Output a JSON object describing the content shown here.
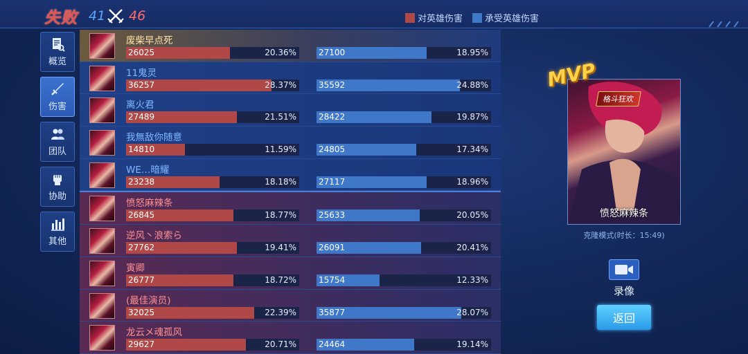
{
  "header": {
    "result": "失败",
    "blue_kills": "41",
    "red_kills": "46",
    "legend": [
      {
        "label": "对英雄伤害",
        "color": "#b04848"
      },
      {
        "label": "承受英雄伤害",
        "color": "#3f78c8"
      }
    ]
  },
  "sidebar": {
    "items": [
      {
        "label": "概览",
        "icon": "overview-icon",
        "active": false
      },
      {
        "label": "伤害",
        "icon": "sword-icon",
        "active": true
      },
      {
        "label": "团队",
        "icon": "team-icon",
        "active": false
      },
      {
        "label": "协助",
        "icon": "fist-icon",
        "active": false
      },
      {
        "label": "其他",
        "icon": "bar-chart-icon",
        "active": false
      }
    ]
  },
  "players": [
    {
      "name": "废柴早点死",
      "dealt": "26025",
      "dealt_pct": "20.36%",
      "dealt_ratio": 0.6,
      "taken": "27100",
      "taken_pct": "18.95%",
      "taken_ratio": 0.63
    },
    {
      "name": "11鬼灵",
      "dealt": "36257",
      "dealt_pct": "28.37%",
      "dealt_ratio": 0.84,
      "taken": "35592",
      "taken_pct": "24.88%",
      "taken_ratio": 0.82
    },
    {
      "name": "离火君",
      "dealt": "27489",
      "dealt_pct": "21.51%",
      "dealt_ratio": 0.64,
      "taken": "28422",
      "taken_pct": "19.87%",
      "taken_ratio": 0.66
    },
    {
      "name": "我無敌你随意",
      "dealt": "14810",
      "dealt_pct": "11.59%",
      "dealt_ratio": 0.34,
      "taken": "24805",
      "taken_pct": "17.34%",
      "taken_ratio": 0.57
    },
    {
      "name": "WE…暗耀",
      "dealt": "23238",
      "dealt_pct": "18.18%",
      "dealt_ratio": 0.54,
      "taken": "27117",
      "taken_pct": "18.96%",
      "taken_ratio": 0.63
    },
    {
      "name": "愤怒麻辣条",
      "dealt": "26845",
      "dealt_pct": "18.77%",
      "dealt_ratio": 0.62,
      "taken": "25633",
      "taken_pct": "20.05%",
      "taken_ratio": 0.59
    },
    {
      "name": "逆风丶浪索ら",
      "dealt": "27762",
      "dealt_pct": "19.41%",
      "dealt_ratio": 0.64,
      "taken": "26091",
      "taken_pct": "20.41%",
      "taken_ratio": 0.6
    },
    {
      "name": "寅卿",
      "dealt": "26777",
      "dealt_pct": "18.72%",
      "dealt_ratio": 0.62,
      "taken": "15754",
      "taken_pct": "12.33%",
      "taken_ratio": 0.36
    },
    {
      "name": "(最佳演员)",
      "dealt": "32025",
      "dealt_pct": "22.39%",
      "dealt_ratio": 0.74,
      "taken": "35877",
      "taken_pct": "28.07%",
      "taken_ratio": 0.83
    },
    {
      "name": "龙云メ魂孤风",
      "dealt": "29627",
      "dealt_pct": "20.71%",
      "dealt_ratio": 0.69,
      "taken": "24464",
      "taken_pct": "19.14%",
      "taken_ratio": 0.56
    }
  ],
  "mvp": {
    "badge": "MVP",
    "tag": "格斗狂欢",
    "name": "愤怒麻辣条"
  },
  "mode_text": "克隆模式(时长：15:49)",
  "replay_label": "录像",
  "back_label": "返回"
}
